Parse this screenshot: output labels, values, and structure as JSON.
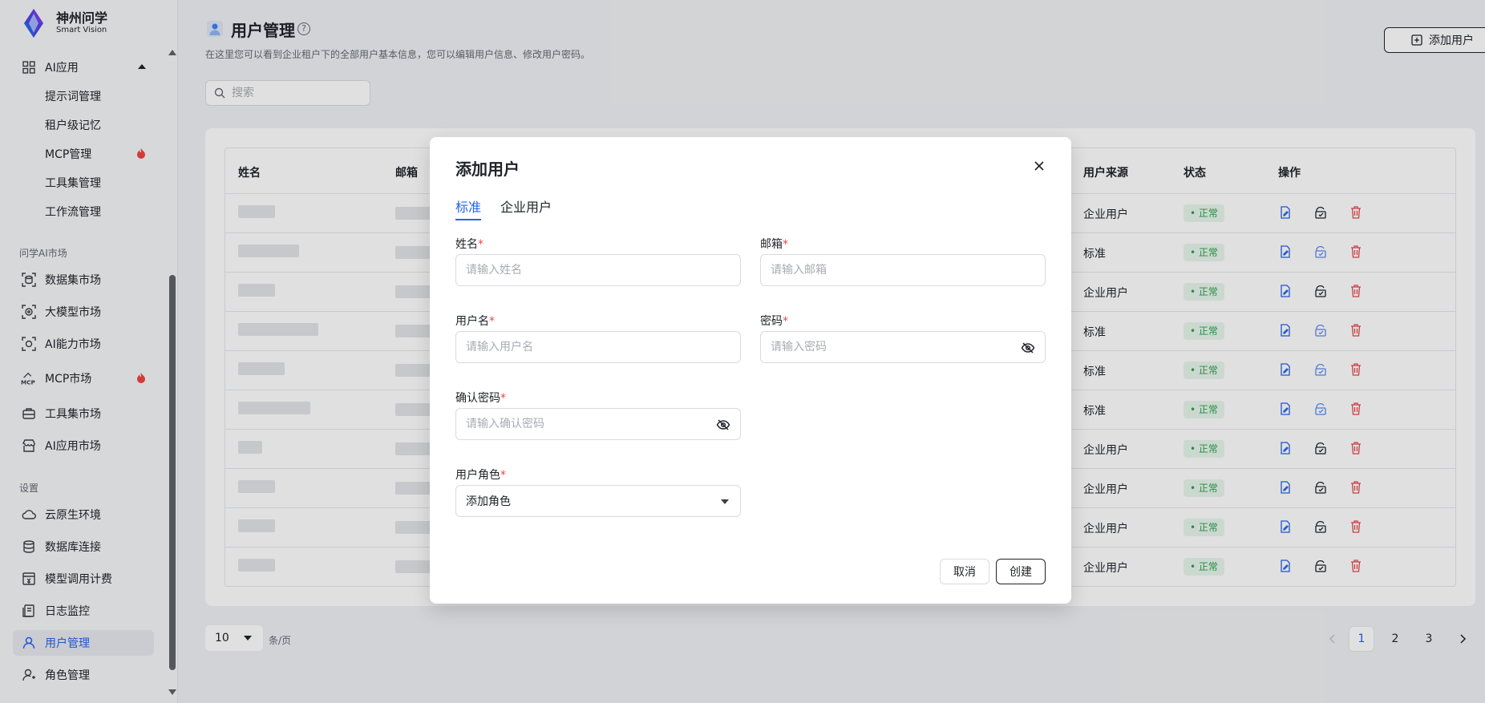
{
  "app": {
    "logo_cn": "神州问学",
    "logo_en": "Smart Vision"
  },
  "sidebar": {
    "items": [
      {
        "label": "AI应用",
        "icon": "grid-icon"
      },
      {
        "label": "提示词管理"
      },
      {
        "label": "租户级记忆"
      },
      {
        "label": "MCP管理",
        "hot": true
      },
      {
        "label": "工具集管理"
      },
      {
        "label": "工作流管理"
      },
      {
        "label": "数据集市场",
        "icon": "dataset-icon"
      },
      {
        "label": "大模型市场",
        "icon": "model-icon"
      },
      {
        "label": "AI能力市场",
        "icon": "ai-ability-icon"
      },
      {
        "label": "MCP市场",
        "icon": "mcp-icon",
        "hot": true
      },
      {
        "label": "工具集市场",
        "icon": "toolbox-icon"
      },
      {
        "label": "AI应用市场",
        "icon": "store-icon"
      },
      {
        "label": "云原生环境",
        "icon": "cloud-icon"
      },
      {
        "label": "数据库连接",
        "icon": "database-icon"
      },
      {
        "label": "模型调用计费",
        "icon": "billing-icon"
      },
      {
        "label": "日志监控",
        "icon": "log-icon"
      },
      {
        "label": "用户管理",
        "icon": "user-icon",
        "active": true
      },
      {
        "label": "角色管理",
        "icon": "role-icon"
      }
    ],
    "sections": {
      "market": "问学AI市场",
      "settings": "设置"
    }
  },
  "header": {
    "title": "用户管理",
    "description": "在这里您可以看到企业租户下的全部用户基本信息，您可以编辑用户信息、修改用户密码。",
    "add_button": "添加用户"
  },
  "search": {
    "placeholder": "搜索"
  },
  "table": {
    "columns": {
      "name": "姓名",
      "email": "邮箱",
      "source": "用户来源",
      "status": "状态",
      "ops": "操作"
    },
    "rows": [
      {
        "source": "企业用户",
        "status": "正常"
      },
      {
        "source": "标准",
        "status": "正常"
      },
      {
        "source": "企业用户",
        "status": "正常"
      },
      {
        "source": "标准",
        "status": "正常"
      },
      {
        "source": "标准",
        "status": "正常"
      },
      {
        "source": "标准",
        "status": "正常"
      },
      {
        "source": "企业用户",
        "status": "正常"
      },
      {
        "source": "企业用户",
        "status": "正常"
      },
      {
        "source": "企业用户",
        "status": "正常"
      },
      {
        "source": "企业用户",
        "status": "正常"
      }
    ]
  },
  "pagination": {
    "page_size": "10",
    "per_page": "条/页",
    "pages": [
      "1",
      "2",
      "3"
    ],
    "current": "1"
  },
  "modal": {
    "title": "添加用户",
    "tabs": [
      "标准",
      "企业用户"
    ],
    "fields": {
      "name": {
        "label": "姓名",
        "placeholder": "请输入姓名"
      },
      "email": {
        "label": "邮箱",
        "placeholder": "请输入邮箱"
      },
      "username": {
        "label": "用户名",
        "placeholder": "请输入用户名"
      },
      "password": {
        "label": "密码",
        "placeholder": "请输入密码"
      },
      "confirm": {
        "label": "确认密码",
        "placeholder": "请输入确认密码"
      },
      "role": {
        "label": "用户角色",
        "value": "添加角色"
      }
    },
    "required_mark": "*",
    "cancel": "取消",
    "create": "创建"
  },
  "colors": {
    "accent": "#2563eb",
    "status_green": "#2ea14f",
    "danger": "#e5484d",
    "hot": "#ef4444"
  }
}
